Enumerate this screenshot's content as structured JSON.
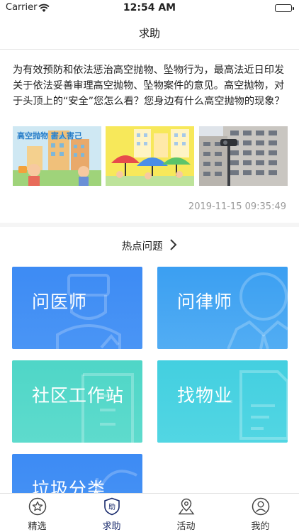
{
  "status_bar": {
    "carrier": "Carrier",
    "time": "12:54 AM"
  },
  "nav": {
    "title": "求助"
  },
  "post": {
    "text": "为有效预防和依法惩治高空抛物、坠物行为，最高法近日印发关于依法妥善审理高空抛物、坠物案件的意见。高空抛物，对于头顶上的“安全”您怎么看？您身边有什么高空抛物的现象？",
    "thumb1_caption": "高空抛物 害人害己",
    "timestamp": "2019-11-15 09:35:49"
  },
  "hot": {
    "title": "热点问题",
    "cards": [
      {
        "label": "问医师"
      },
      {
        "label": "问律师"
      },
      {
        "label": "社区工作站"
      },
      {
        "label": "找物业"
      },
      {
        "label": "垃圾分类"
      }
    ]
  },
  "tabs": [
    {
      "label": "精选"
    },
    {
      "label": "求助",
      "icon_text": "助"
    },
    {
      "label": "活动"
    },
    {
      "label": "我的"
    }
  ],
  "colors": {
    "active_tab": "#1a2b6d",
    "card_blue": "#3d8bf4",
    "card_teal": "#4fd6c7"
  }
}
